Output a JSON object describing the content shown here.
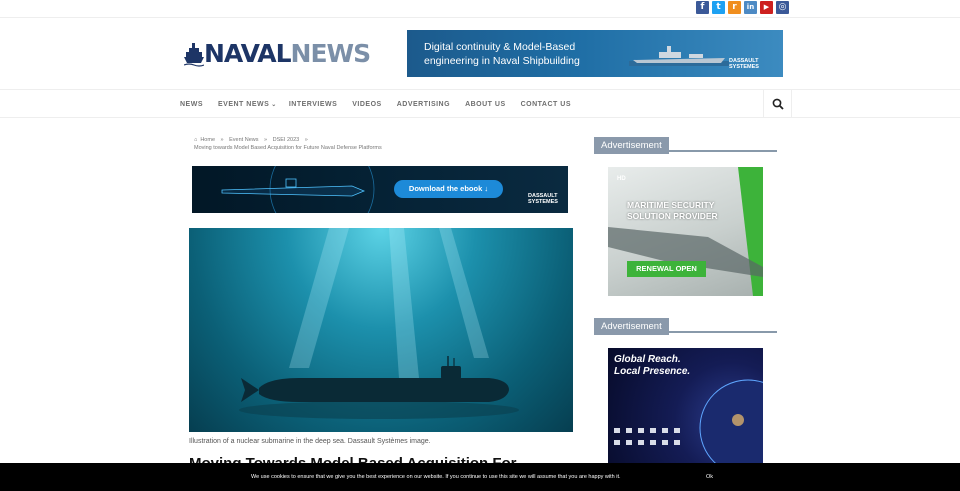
{
  "social": [
    {
      "icon": "facebook-icon",
      "glyph": "f",
      "color": "#3b5998"
    },
    {
      "icon": "twitter-icon",
      "glyph": "t",
      "color": "#1da1f2"
    },
    {
      "icon": "rss-icon",
      "glyph": "r",
      "color": "#f08e1e"
    },
    {
      "icon": "linkedin-icon",
      "glyph": "in",
      "color": "#4d8ac4"
    },
    {
      "icon": "youtube-icon",
      "glyph": "▶",
      "color": "#cd201f"
    },
    {
      "icon": "instagram-icon",
      "glyph": "◎",
      "color": "#3b5998"
    }
  ],
  "logo": {
    "naval": "NAVAL",
    "news": "NEWS"
  },
  "top_banner": {
    "line1": "Digital continuity & Model-Based",
    "line2": "engineering in Naval Shipbuilding",
    "brand1": "DASSAULT",
    "brand2": "SYSTEMES"
  },
  "nav": {
    "items": [
      {
        "label": "NEWS"
      },
      {
        "label": "EVENT NEWS",
        "dropdown": true
      },
      {
        "label": "INTERVIEWS"
      },
      {
        "label": "VIDEOS"
      },
      {
        "label": "ADVERTISING"
      },
      {
        "label": "ABOUT US"
      },
      {
        "label": "CONTACT US"
      }
    ],
    "search_icon": "search-icon"
  },
  "breadcrumb": {
    "home": "Home",
    "event_news": "Event News",
    "dsei": "DSEI 2023",
    "current": "Moving towards Model Based Acquisition for Future Naval Defense Platforms"
  },
  "ebook_banner": {
    "button": "Download the ebook ↓",
    "brand1": "DASSAULT",
    "brand2": "SYSTEMES"
  },
  "article": {
    "caption": "Illustration of a nuclear submarine in the deep sea. Dassault Systèmes image.",
    "title": "Moving Towards Model Based Acquisition For"
  },
  "sidebar": {
    "ad_label": "Advertisement",
    "ad1": {
      "brand": "HD",
      "title_line1": "MARITIME SECURITY",
      "title_line2": "SOLUTION PROVIDER",
      "button": "RENEWAL OPEN"
    },
    "ad2": {
      "title_line1": "Global Reach.",
      "title_line2": "Local Presence."
    }
  },
  "cookie": {
    "message": "We use cookies to ensure that we give you the best experience on our website. If you continue to use this site we will assume that you are happy with it.",
    "ok": "Ok"
  }
}
